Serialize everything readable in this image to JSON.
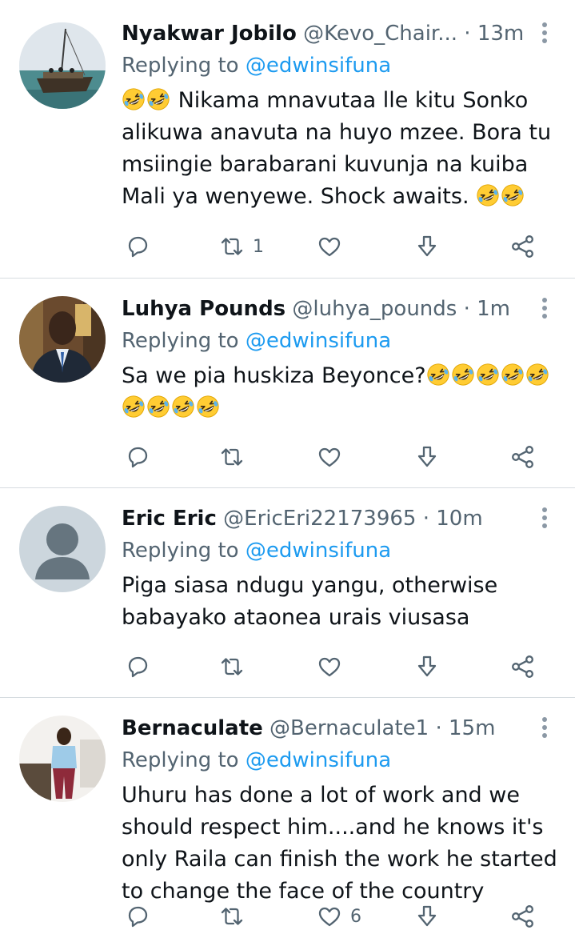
{
  "tweets": [
    {
      "name": "Nyakwar Jobilo",
      "handle": "@Kevo_Chair...",
      "dot": "·",
      "time": "13m",
      "replying_label": "Replying to",
      "replying_to": "@edwinsifuna",
      "lead_emoji_count": 2,
      "text": "Nikama mnavutaa lle kitu Sonko alikuwa anavuta na huyo mzee. Bora tu msiingie barabarani kuvunja na kuiba Mali ya wenyewe. Shock awaits.",
      "trail_emoji_count": 2,
      "retweets": "1",
      "likes": ""
    },
    {
      "name": "Luhya Pounds",
      "handle": "@luhya_pounds",
      "dot": "·",
      "time": "1m",
      "replying_label": "Replying to",
      "replying_to": "@edwinsifuna",
      "lead_emoji_count": 0,
      "text": "Sa we pia huskiza Beyonce?",
      "trail_emoji_count": 9,
      "retweets": "",
      "likes": ""
    },
    {
      "name": "Eric Eric",
      "handle": "@EricEri22173965",
      "dot": "·",
      "time": "10m",
      "replying_label": "Replying to",
      "replying_to": "@edwinsifuna",
      "lead_emoji_count": 0,
      "text": "Piga siasa ndugu yangu, otherwise babayako ataonea urais viusasa",
      "trail_emoji_count": 0,
      "retweets": "",
      "likes": ""
    },
    {
      "name": "Bernaculate",
      "handle": "@Bernaculate1",
      "dot": "·",
      "time": "15m",
      "replying_label": "Replying to",
      "replying_to": "@edwinsifuna",
      "lead_emoji_count": 0,
      "text": "Uhuru has done a lot of work and we should respect him....and he knows it's only Raila can finish the work he started to change the face of the country",
      "trail_emoji_count": 0,
      "retweets": "",
      "likes": "6"
    }
  ],
  "icons": {
    "reply": "reply-icon",
    "retweet": "retweet-icon",
    "like": "heart-icon",
    "download": "download-icon",
    "share": "share-icon",
    "more": "more-options-icon",
    "emoji": "rolling-laughing-emoji"
  },
  "colors": {
    "link": "#1d9bf0",
    "secondary_text": "#536471",
    "divider": "#d6dce0"
  }
}
